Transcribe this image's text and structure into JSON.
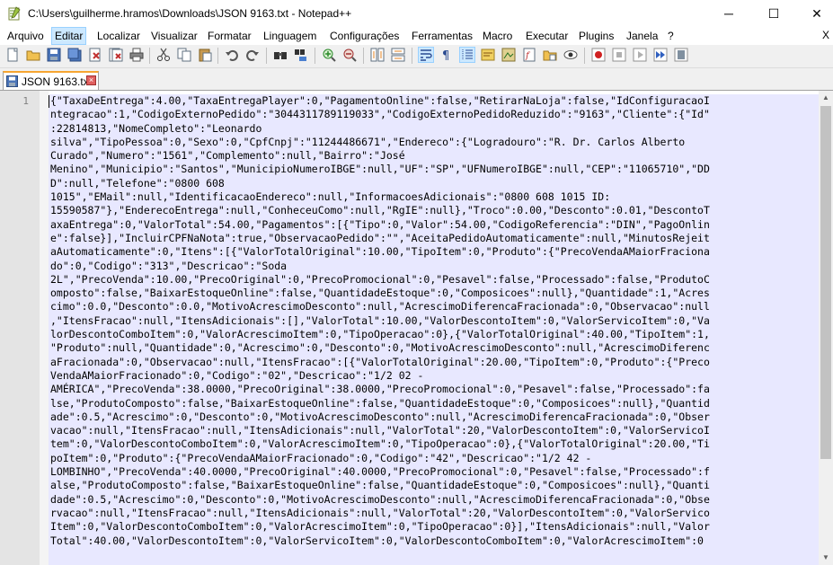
{
  "window": {
    "title": "C:\\Users\\guilherme.hramos\\Downloads\\JSON 9163.txt - Notepad++",
    "minimize": "─",
    "maximize": "☐",
    "close": "✕"
  },
  "menu": {
    "items": [
      "Arquivo",
      "Editar",
      "Localizar",
      "Visualizar",
      "Formatar",
      "Linguagem",
      "Configurações",
      "Ferramentas",
      "Macro",
      "Executar",
      "Plugins",
      "Janela",
      "?"
    ],
    "active_index": 1,
    "close_doc": "X"
  },
  "toolbar": {
    "buttons": [
      "new-file",
      "open-file",
      "save",
      "save-all",
      "close",
      "close-all",
      "print",
      "cut",
      "copy",
      "paste",
      "undo",
      "redo",
      "find",
      "replace",
      "zoom-in",
      "zoom-out",
      "sync-vertical",
      "sync-horizontal",
      "word-wrap",
      "show-all-chars",
      "indent-guide",
      "user-language",
      "document-map",
      "function-list",
      "folder-workspace",
      "monitoring",
      "record-macro",
      "stop-macro",
      "play-macro",
      "run-macro-multiple",
      "save-macro"
    ]
  },
  "tab": {
    "label": "JSON 9163.txt",
    "close": "×"
  },
  "editor": {
    "line_number": "1",
    "lines": [
      "{\"TaxaDeEntrega\":4.00,\"TaxaEntregaPlayer\":0,\"PagamentoOnline\":false,\"RetirarNaLoja\":false,\"IdConfiguracaoI",
      "ntegracao\":1,\"CodigoExternoPedido\":\"3044311789119033\",\"CodigoExternoPedidoReduzido\":\"9163\",\"Cliente\":{\"Id\"",
      ":22814813,\"NomeCompleto\":\"Leonardo",
      "silva\",\"TipoPessoa\":0,\"Sexo\":0,\"CpfCnpj\":\"11244486671\",\"Endereco\":{\"Logradouro\":\"R. Dr. Carlos Alberto",
      "Curado\",\"Numero\":\"1561\",\"Complemento\":null,\"Bairro\":\"José",
      "Menino\",\"Municipio\":\"Santos\",\"MunicipioNumeroIBGE\":null,\"UF\":\"SP\",\"UFNumeroIBGE\":null,\"CEP\":\"11065710\",\"DD",
      "D\":null,\"Telefone\":\"0800 608",
      "1015\",\"EMail\":null,\"IdentificacaoEndereco\":null,\"InformacoesAdicionais\":\"0800 608 1015 ID:",
      "15590587\"},\"EnderecoEntrega\":null,\"ConheceuComo\":null,\"RgIE\":null},\"Troco\":0.00,\"Desconto\":0.01,\"DescontoT",
      "axaEntrega\":0,\"ValorTotal\":54.00,\"Pagamentos\":[{\"Tipo\":0,\"Valor\":54.00,\"CodigoReferencia\":\"DIN\",\"PagoOnlin",
      "e\":false}],\"IncluirCPFNaNota\":true,\"ObservacaoPedido\":\"\",\"AceitaPedidoAutomaticamente\":null,\"MinutosRejeit",
      "aAutomaticamente\":0,\"Itens\":[{\"ValorTotalOriginal\":10.00,\"TipoItem\":0,\"Produto\":{\"PrecoVendaAMaiorFraciona",
      "do\":0,\"Codigo\":\"313\",\"Descricao\":\"Soda",
      "2L\",\"PrecoVenda\":10.00,\"PrecoOriginal\":0,\"PrecoPromocional\":0,\"Pesavel\":false,\"Processado\":false,\"ProdutoC",
      "omposto\":false,\"BaixarEstoqueOnline\":false,\"QuantidadeEstoque\":0,\"Composicoes\":null},\"Quantidade\":1,\"Acres",
      "cimo\":0.0,\"Desconto\":0.0,\"MotivoAcrescimoDesconto\":null,\"AcrescimoDiferencaFracionada\":0,\"Observacao\":null",
      ",\"ItensFracao\":null,\"ItensAdicionais\":[],\"ValorTotal\":10.00,\"ValorDescontoItem\":0,\"ValorServicoItem\":0,\"Va",
      "lorDescontoComboItem\":0,\"ValorAcrescimoItem\":0,\"TipoOperacao\":0},{\"ValorTotalOriginal\":40.00,\"TipoItem\":1,",
      "\"Produto\":null,\"Quantidade\":0,\"Acrescimo\":0,\"Desconto\":0,\"MotivoAcrescimoDesconto\":null,\"AcrescimoDiferenc",
      "aFracionada\":0,\"Observacao\":null,\"ItensFracao\":[{\"ValorTotalOriginal\":20.00,\"TipoItem\":0,\"Produto\":{\"Preco",
      "VendaAMaiorFracionado\":0,\"Codigo\":\"02\",\"Descricao\":\"1/2 02 -",
      "AMÉRICA\",\"PrecoVenda\":38.0000,\"PrecoOriginal\":38.0000,\"PrecoPromocional\":0,\"Pesavel\":false,\"Processado\":fa",
      "lse,\"ProdutoComposto\":false,\"BaixarEstoqueOnline\":false,\"QuantidadeEstoque\":0,\"Composicoes\":null},\"Quantid",
      "ade\":0.5,\"Acrescimo\":0,\"Desconto\":0,\"MotivoAcrescimoDesconto\":null,\"AcrescimoDiferencaFracionada\":0,\"Obser",
      "vacao\":null,\"ItensFracao\":null,\"ItensAdicionais\":null,\"ValorTotal\":20,\"ValorDescontoItem\":0,\"ValorServicoI",
      "tem\":0,\"ValorDescontoComboItem\":0,\"ValorAcrescimoItem\":0,\"TipoOperacao\":0},{\"ValorTotalOriginal\":20.00,\"Ti",
      "poItem\":0,\"Produto\":{\"PrecoVendaAMaiorFracionado\":0,\"Codigo\":\"42\",\"Descricao\":\"1/2 42 -",
      "LOMBINHO\",\"PrecoVenda\":40.0000,\"PrecoOriginal\":40.0000,\"PrecoPromocional\":0,\"Pesavel\":false,\"Processado\":f",
      "alse,\"ProdutoComposto\":false,\"BaixarEstoqueOnline\":false,\"QuantidadeEstoque\":0,\"Composicoes\":null},\"Quanti",
      "dade\":0.5,\"Acrescimo\":0,\"Desconto\":0,\"MotivoAcrescimoDesconto\":null,\"AcrescimoDiferencaFracionada\":0,\"Obse",
      "rvacao\":null,\"ItensFracao\":null,\"ItensAdicionais\":null,\"ValorTotal\":20,\"ValorDescontoItem\":0,\"ValorServico",
      "Item\":0,\"ValorDescontoComboItem\":0,\"ValorAcrescimoItem\":0,\"TipoOperacao\":0}],\"ItensAdicionais\":null,\"Valor",
      "Total\":40.00,\"ValorDescontoItem\":0,\"ValorServicoItem\":0,\"ValorDescontoComboItem\":0,\"ValorAcrescimoItem\":0"
    ]
  }
}
